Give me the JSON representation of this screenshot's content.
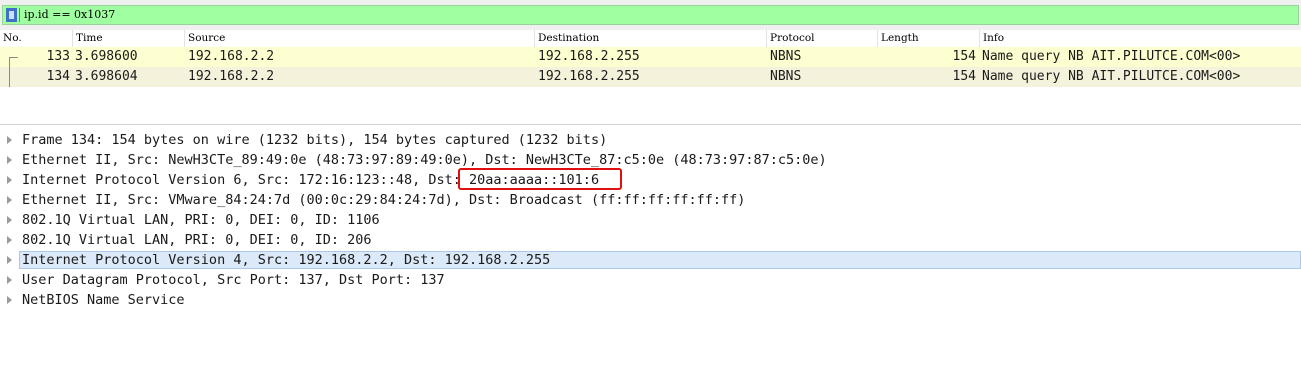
{
  "filter": {
    "value": "ip.id == 0x1037"
  },
  "packet_list": {
    "columns": [
      "No.",
      "Time",
      "Source",
      "Destination",
      "Protocol",
      "Length",
      "Info"
    ],
    "rows": [
      {
        "no": "133",
        "time": "3.698600",
        "source": "192.168.2.2",
        "destination": "192.168.2.255",
        "protocol": "NBNS",
        "length": "154",
        "info": "Name query NB AIT.PILUTCE.COM<00>"
      },
      {
        "no": "134",
        "time": "3.698604",
        "source": "192.168.2.2",
        "destination": "192.168.2.255",
        "protocol": "NBNS",
        "length": "154",
        "info": "Name query NB AIT.PILUTCE.COM<00>"
      }
    ]
  },
  "details": {
    "items": [
      "Frame 134: 154 bytes on wire (1232 bits), 154 bytes captured (1232 bits)",
      "Ethernet II, Src: NewH3CTe_89:49:0e (48:73:97:89:49:0e), Dst: NewH3CTe_87:c5:0e (48:73:97:87:c5:0e)",
      "Internet Protocol Version 6, Src: 172:16:123::48, Dst: 20aa:aaaa::101:6",
      "Ethernet II, Src: VMware_84:24:7d (00:0c:29:84:24:7d), Dst: Broadcast (ff:ff:ff:ff:ff:ff)",
      "802.1Q Virtual LAN, PRI: 0, DEI: 0, ID: 1106",
      "802.1Q Virtual LAN, PRI: 0, DEI: 0, ID: 206",
      "Internet Protocol Version 4, Src: 192.168.2.2, Dst: 192.168.2.255",
      "User Datagram Protocol, Src Port: 137, Dst Port: 137",
      "NetBIOS Name Service"
    ],
    "selected_index": 6,
    "highlighted_value": "20aa:aaaa::101:6"
  },
  "colors": {
    "filter_valid": "#a0ffa0",
    "row_odd": "#feffd0",
    "row_even": "#f5f2dc",
    "selection": "#dbe9f8",
    "annotation_box": "#e01010"
  }
}
